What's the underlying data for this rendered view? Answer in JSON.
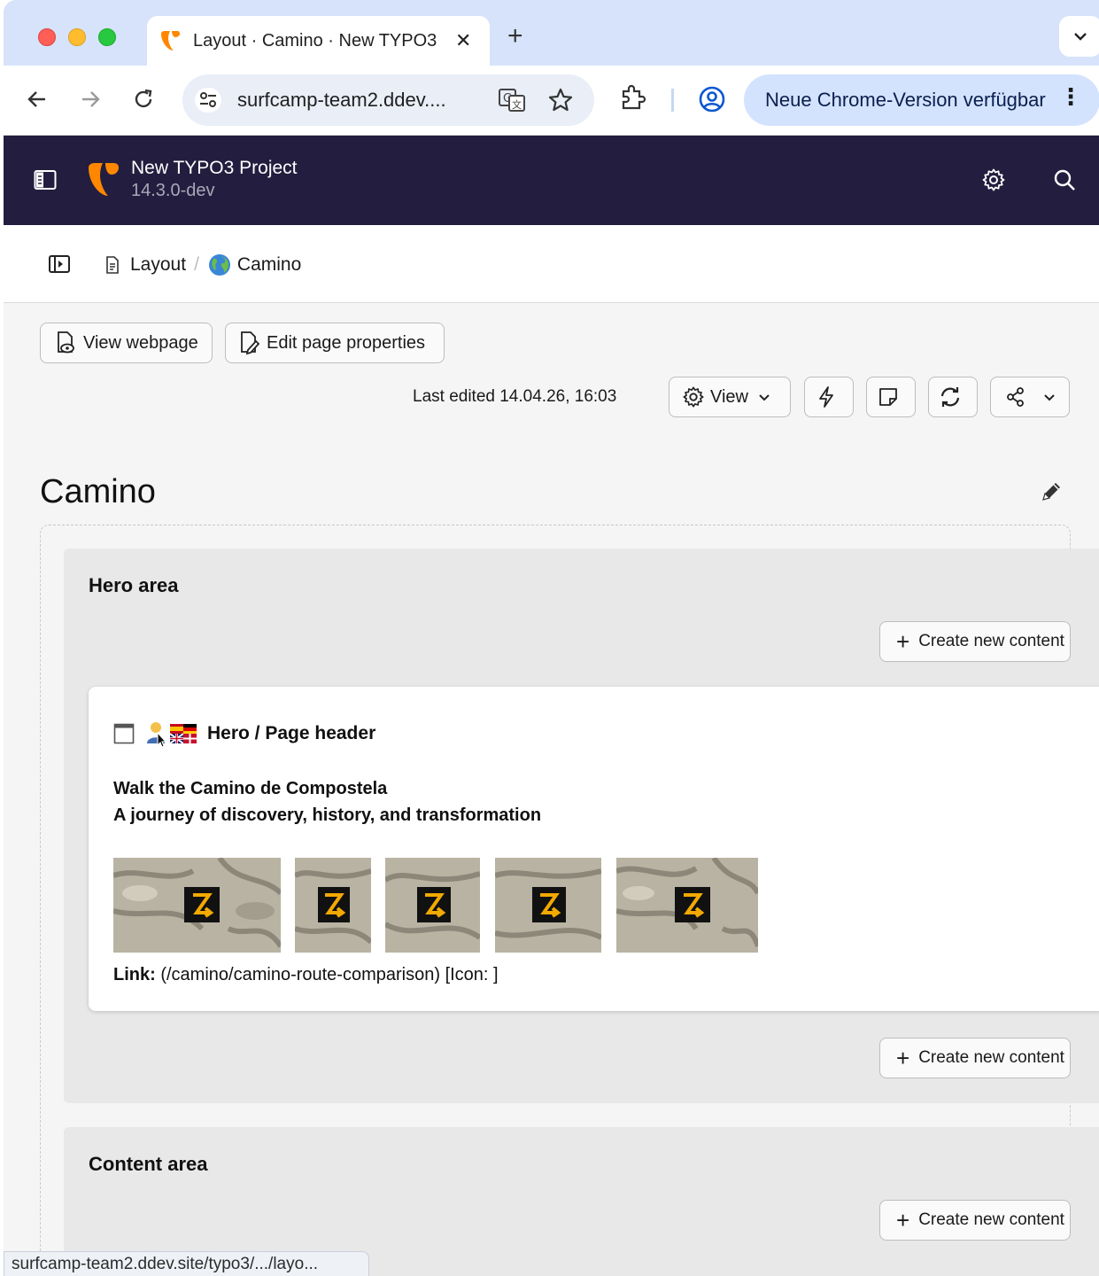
{
  "browser": {
    "tab_title": "Layout · Camino · New TYPO3",
    "tab_close": "✕",
    "new_tab": "+",
    "url": "surfcamp-team2.ddev....",
    "update_label": "Neue Chrome-Version verfügbar",
    "menu_dots": "⋮",
    "status_url": "surfcamp-team2.ddev.site/typo3/.../layo..."
  },
  "typo3": {
    "site_name": "New TYPO3 Project",
    "version": "14.3.0-dev",
    "brand_color": "#ff8700"
  },
  "breadcrumb": {
    "items": [
      "Layout",
      "Camino"
    ],
    "separator": "/"
  },
  "actions": {
    "view_webpage": "View webpage",
    "edit_page_properties": "Edit page properties",
    "last_edited": "Last edited 14.04.26, 16:03",
    "view_label": "View"
  },
  "page": {
    "title": "Camino"
  },
  "areas": [
    {
      "title": "Hero area",
      "create_label": "Create new content",
      "elements": [
        {
          "title": "Hero / Page header",
          "header": "Walk the Camino de Compostela",
          "subheader": "A journey of discovery, history, and transformation",
          "image_count": 5,
          "link_label": "Link:",
          "link_value": "(/camino/camino-route-comparison) [Icon: ]"
        }
      ],
      "create_label_bottom": "Create new content"
    },
    {
      "title": "Content area",
      "create_label": "Create new content"
    }
  ]
}
